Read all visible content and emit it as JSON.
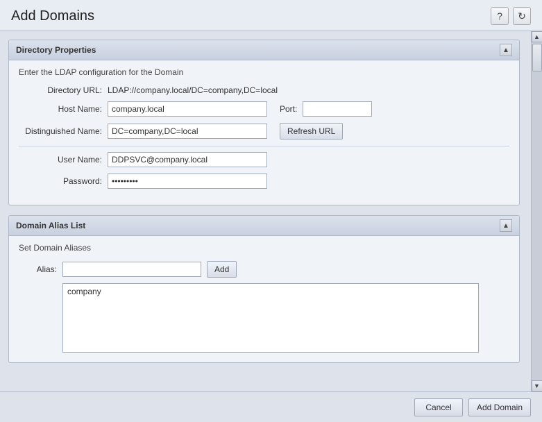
{
  "header": {
    "title": "Add Domains",
    "help_icon": "?",
    "refresh_icon": "↻"
  },
  "directory_properties": {
    "panel_title": "Directory Properties",
    "subtitle": "Enter the LDAP configuration for the Domain",
    "collapse_icon": "▲",
    "fields": {
      "directory_url_label": "Directory URL:",
      "directory_url_value": "LDAP://company.local/DC=company,DC=local",
      "host_name_label": "Host Name:",
      "host_name_value": "company.local",
      "port_label": "Port:",
      "port_value": "",
      "distinguished_name_label": "Distinguished Name:",
      "distinguished_name_value": "DC=company,DC=local",
      "refresh_url_label": "Refresh URL",
      "user_name_label": "User Name:",
      "user_name_value": "DDPSVC@company.local",
      "password_label": "Password:",
      "password_value": "••••••••"
    }
  },
  "domain_alias_list": {
    "panel_title": "Domain Alias List",
    "subtitle": "Set Domain Aliases",
    "collapse_icon": "▲",
    "alias_label": "Alias:",
    "alias_input_value": "",
    "add_button_label": "Add",
    "alias_list_content": "company"
  },
  "footer": {
    "cancel_label": "Cancel",
    "add_domain_label": "Add Domain"
  }
}
